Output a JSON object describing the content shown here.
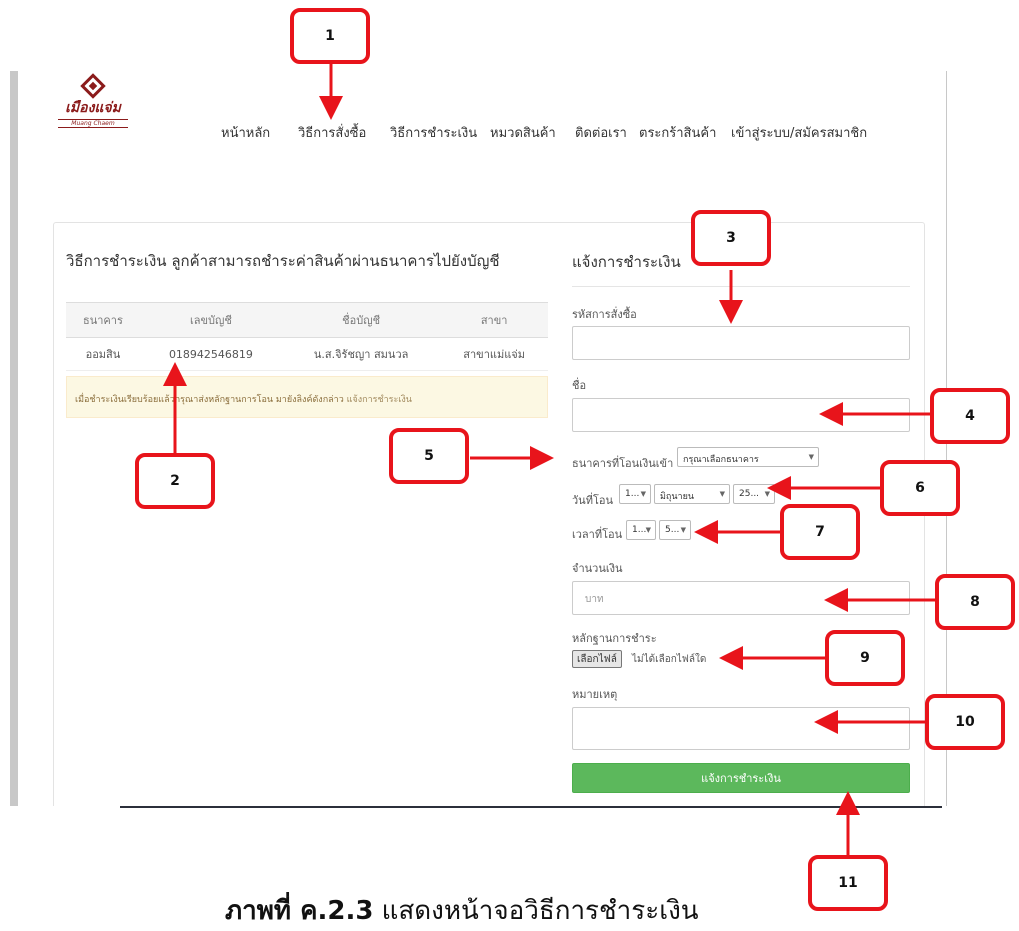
{
  "logo": {
    "brand": "เมืองแจ่ม",
    "tagline": "Muang Chaem"
  },
  "nav": [
    "หน้าหลัก",
    "วิธีการสั่งซื้อ",
    "วิธีการชำระเงิน",
    "หมวดสินค้า",
    "ติดต่อเรา",
    "ตระกร้าสินค้า",
    "เข้าสู่ระบบ/สมัครสมาชิก"
  ],
  "payment_info": {
    "title": "วิธีการชำระเงิน ลูกค้าสามารถชำระค่าสินค้าผ่านธนาคารไปยังบัญชี",
    "columns": [
      "ธนาคาร",
      "เลขบัญชี",
      "ชื่อบัญชี",
      "สาขา"
    ],
    "rows": [
      [
        "ออมสิน",
        "018942546819",
        "น.ส.จิรัชญา สมนวล",
        "สาขาแม่แจ่ม"
      ]
    ],
    "notice": "เมื่อชำระเงินเรียบร้อยแล้วกรุณาส่งหลักฐานการโอน มายังลิงค์ดังกล่าว",
    "notice_link": "แจ้งการชำระเงิน"
  },
  "form": {
    "title": "แจ้งการชำระเงิน",
    "order_code_label": "รหัสการสั่งซื้อ",
    "name_label": "ชื่อ",
    "bank_label": "ธนาคารที่โอนเงินเข้า",
    "bank_select": "กรุณาเลือกธนาคาร",
    "date_label": "วันที่โอน",
    "date_day": "1...",
    "date_month": "มิถุนายน",
    "date_year": "25...",
    "time_label": "เวลาที่โอน",
    "time_hour": "1...",
    "time_minute": "5...",
    "amount_label": "จำนวนเงิน",
    "amount_placeholder": "บาท",
    "proof_label": "หลักฐานการชำระ",
    "file_button": "เลือกไฟล์",
    "file_status": "ไม่ได้เลือกไฟล์ใด",
    "note_label": "หมายเหตุ",
    "submit_label": "แจ้งการชำระเงิน"
  },
  "callouts": [
    "1",
    "2",
    "3",
    "4",
    "5",
    "6",
    "7",
    "8",
    "9",
    "10",
    "11"
  ],
  "caption": {
    "prefix": "ภาพที่ ",
    "number": "ค.2.3",
    "text": " แสดงหน้าจอวิธีการชำระเงิน"
  },
  "colors": {
    "accent_red": "#e8141b",
    "submit_green": "#5cb85c",
    "brand": "#8b1b1b"
  }
}
